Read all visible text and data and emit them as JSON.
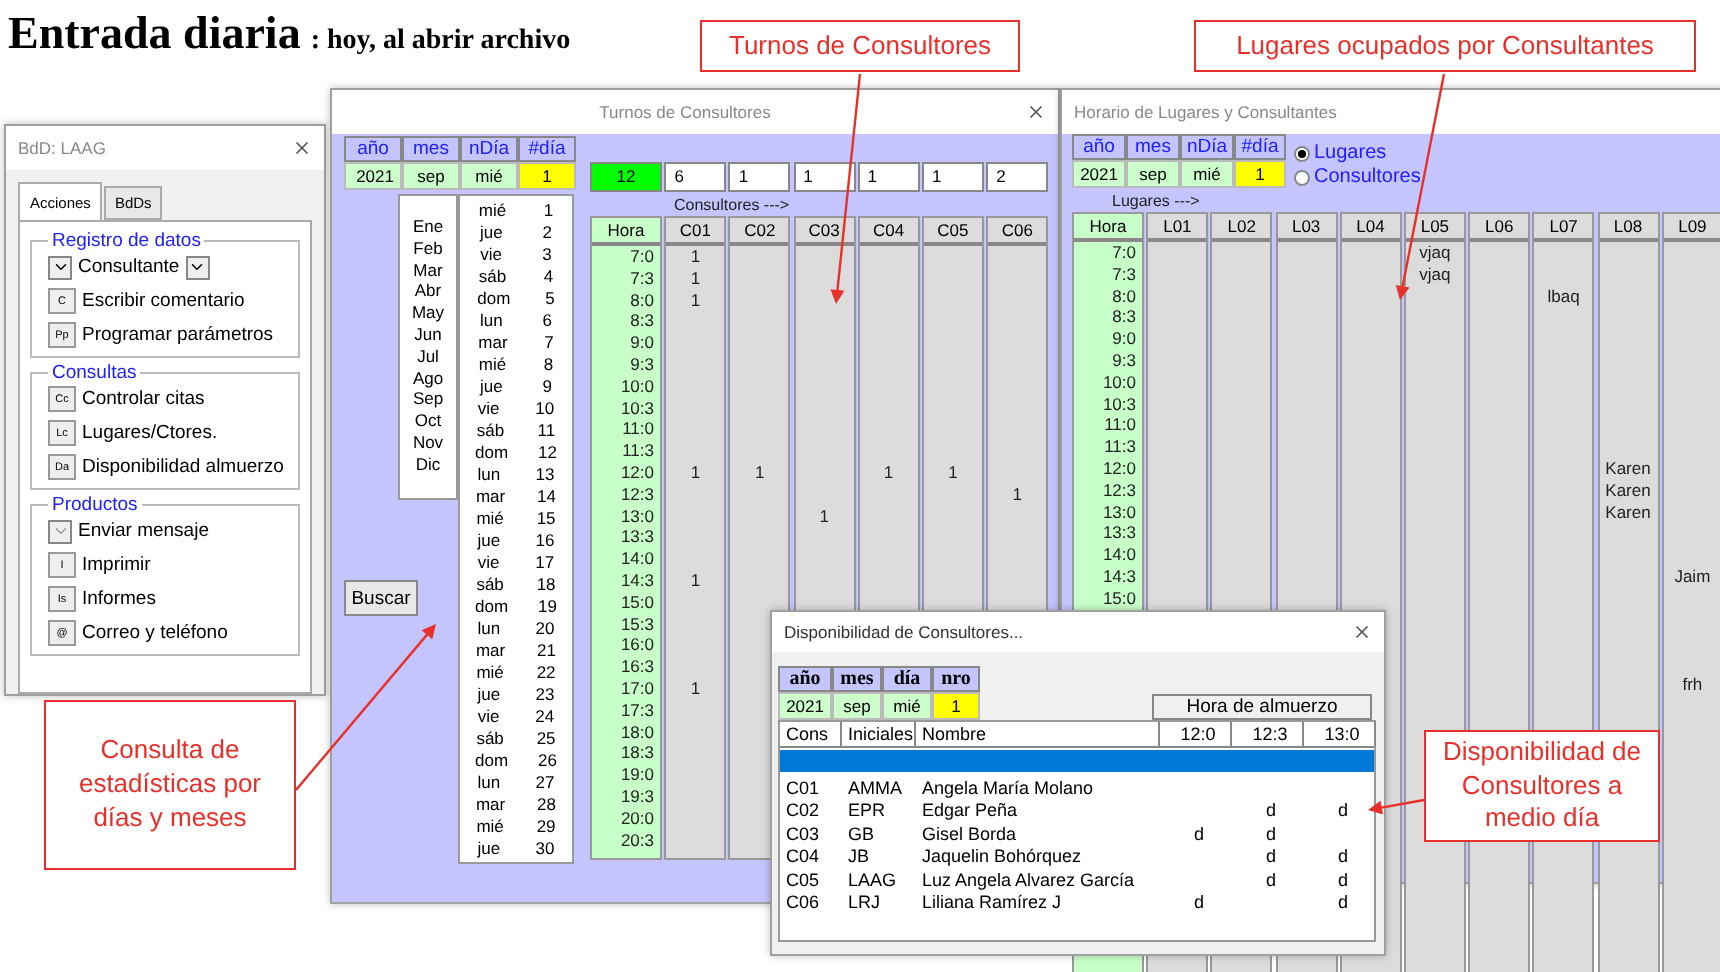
{
  "heading": {
    "main": "Entrada diaria",
    "sub": ": hoy, al abrir archivo"
  },
  "callouts": [
    {
      "text": "Turnos de Consultores"
    },
    {
      "text": "Lugares ocupados por Consultantes"
    },
    {
      "text": "Consulta de estadísticas por días y meses"
    },
    {
      "text": "Disponibilidad de Consultores a medio día"
    }
  ],
  "panel": {
    "title": "BdD: LAAG",
    "tabs": [
      {
        "label": "Acciones",
        "selected": true
      },
      {
        "label": "BdDs",
        "selected": false
      }
    ],
    "groups": [
      {
        "title": "Registro de datos",
        "items": [
          {
            "kind": "picker",
            "label": "Consultante"
          },
          {
            "kind": "key",
            "key": "C",
            "label": "Escribir comentario"
          },
          {
            "kind": "key",
            "key": "Pp",
            "label": "Programar parámetros"
          }
        ]
      },
      {
        "title": "Consultas",
        "items": [
          {
            "kind": "key",
            "key": "Cc",
            "label": "Controlar citas"
          },
          {
            "kind": "key",
            "key": "Lc",
            "label": "Lugares/Ctores."
          },
          {
            "kind": "key",
            "key": "Da",
            "label": "Disponibilidad almuerzo"
          }
        ]
      },
      {
        "title": "Productos",
        "items": [
          {
            "kind": "dropdown",
            "label": "Enviar mensaje"
          },
          {
            "kind": "key",
            "key": "I",
            "label": "Imprimir"
          },
          {
            "kind": "key",
            "key": "Is",
            "label": "Informes"
          },
          {
            "kind": "key",
            "key": "@",
            "label": "Correo y teléfono"
          }
        ]
      }
    ]
  },
  "turnos": {
    "title": "Turnos de Consultores",
    "date": {
      "labels": [
        "año",
        "mes",
        "nDía",
        "#día"
      ],
      "values": [
        {
          "text": "2021",
          "color": "#ccffcc"
        },
        {
          "text": "sep",
          "color": "#ccffcc"
        },
        {
          "text": "mié",
          "color": "#ccffcc"
        },
        {
          "text": "1",
          "color": "#ffff00"
        }
      ]
    },
    "months": [
      "Ene",
      "Feb",
      "Mar",
      "Abr",
      "May",
      "Jun",
      "Jul",
      "Ago",
      "Sep",
      "Oct",
      "Nov",
      "Dic"
    ],
    "days": [
      {
        "weekday": "mié",
        "day": "1"
      },
      {
        "weekday": "jue",
        "day": "2"
      },
      {
        "weekday": "vie",
        "day": "3"
      },
      {
        "weekday": "sáb",
        "day": "4"
      },
      {
        "weekday": "dom",
        "day": "5"
      },
      {
        "weekday": "lun",
        "day": "6"
      },
      {
        "weekday": "mar",
        "day": "7"
      },
      {
        "weekday": "mié",
        "day": "8"
      },
      {
        "weekday": "jue",
        "day": "9"
      },
      {
        "weekday": "vie",
        "day": "10"
      },
      {
        "weekday": "sáb",
        "day": "11"
      },
      {
        "weekday": "dom",
        "day": "12"
      },
      {
        "weekday": "lun",
        "day": "13"
      },
      {
        "weekday": "mar",
        "day": "14"
      },
      {
        "weekday": "mié",
        "day": "15"
      },
      {
        "weekday": "jue",
        "day": "16"
      },
      {
        "weekday": "vie",
        "day": "17"
      },
      {
        "weekday": "sáb",
        "day": "18"
      },
      {
        "weekday": "dom",
        "day": "19"
      },
      {
        "weekday": "lun",
        "day": "20"
      },
      {
        "weekday": "mar",
        "day": "21"
      },
      {
        "weekday": "mié",
        "day": "22"
      },
      {
        "weekday": "jue",
        "day": "23"
      },
      {
        "weekday": "vie",
        "day": "24"
      },
      {
        "weekday": "sáb",
        "day": "25"
      },
      {
        "weekday": "dom",
        "day": "26"
      },
      {
        "weekday": "lun",
        "day": "27"
      },
      {
        "weekday": "mar",
        "day": "28"
      },
      {
        "weekday": "mié",
        "day": "29"
      },
      {
        "weekday": "jue",
        "day": "30"
      }
    ],
    "search_button": "Buscar",
    "counts": [
      {
        "text": "12",
        "color": "#00ff00"
      },
      {
        "text": "6",
        "color": "#ffffff"
      },
      {
        "text": "1",
        "color": "#ffffff"
      },
      {
        "text": "1",
        "color": "#ffffff"
      },
      {
        "text": "1",
        "color": "#ffffff"
      },
      {
        "text": "1",
        "color": "#ffffff"
      },
      {
        "text": "2",
        "color": "#ffffff"
      }
    ],
    "group_label": "Consultores --->",
    "hour_label": "Hora",
    "times": [
      "7:0",
      "7:3",
      "8:0",
      "8:3",
      "9:0",
      "9:3",
      "10:0",
      "10:3",
      "11:0",
      "11:3",
      "12:0",
      "12:3",
      "13:0",
      "13:3",
      "14:0",
      "14:3",
      "15:0",
      "15:3",
      "16:0",
      "16:3",
      "17:0",
      "17:3",
      "18:0",
      "18:3",
      "19:0",
      "19:3",
      "20:0",
      "20:3"
    ],
    "columns": [
      {
        "label": "C01",
        "cells": [
          "1",
          "1",
          "1",
          null,
          null,
          null,
          null,
          null,
          null,
          null,
          "1",
          null,
          null,
          null,
          null,
          "1",
          null,
          null,
          null,
          null,
          "1"
        ]
      },
      {
        "label": "C02",
        "cells": [
          null,
          null,
          null,
          null,
          null,
          null,
          null,
          null,
          null,
          null,
          "1"
        ]
      },
      {
        "label": "C03",
        "cells": [
          null,
          null,
          null,
          null,
          null,
          null,
          null,
          null,
          null,
          null,
          null,
          null,
          "1"
        ]
      },
      {
        "label": "C04",
        "cells": [
          null,
          null,
          null,
          null,
          null,
          null,
          null,
          null,
          null,
          null,
          "1"
        ]
      },
      {
        "label": "C05",
        "cells": [
          null,
          null,
          null,
          null,
          null,
          null,
          null,
          null,
          null,
          null,
          "1"
        ]
      },
      {
        "label": "C06",
        "cells": [
          null,
          null,
          null,
          null,
          null,
          null,
          null,
          null,
          null,
          null,
          null,
          "1"
        ]
      }
    ]
  },
  "horario": {
    "title": "Horario de Lugares y Consultantes",
    "date": {
      "labels": [
        "año",
        "mes",
        "nDía",
        "#día"
      ],
      "values": [
        {
          "text": "2021",
          "color": "#ccffcc"
        },
        {
          "text": "sep",
          "color": "#ccffcc"
        },
        {
          "text": "mié",
          "color": "#ccffcc"
        },
        {
          "text": "1",
          "color": "#ffff00"
        }
      ]
    },
    "options": [
      {
        "label": "Lugares",
        "selected": true
      },
      {
        "label": "Consultores",
        "selected": false
      }
    ],
    "group_label": "Lugares --->",
    "hour_label": "Hora",
    "times": [
      "7:0",
      "7:3",
      "8:0",
      "8:3",
      "9:0",
      "9:3",
      "10:0",
      "10:3",
      "11:0",
      "11:3",
      "12:0",
      "12:3",
      "13:0",
      "13:3",
      "14:0",
      "14:3",
      "15:0"
    ],
    "columns": [
      {
        "label": "L01"
      },
      {
        "label": "L02"
      },
      {
        "label": "L03"
      },
      {
        "label": "L04"
      },
      {
        "label": "L05",
        "cells": [
          "vjaq",
          "vjaq"
        ]
      },
      {
        "label": "L06"
      },
      {
        "label": "L07",
        "cells": [
          null,
          null,
          "lbaq"
        ]
      },
      {
        "label": "L08",
        "cells": [
          null,
          null,
          null,
          null,
          null,
          null,
          null,
          null,
          null,
          null,
          "Karen",
          "Karen",
          "Karen"
        ]
      },
      {
        "label": "L09",
        "cells": [
          null,
          null,
          null,
          null,
          null,
          null,
          null,
          null,
          null,
          null,
          null,
          null,
          null,
          null,
          null,
          "Jaim",
          null,
          null,
          null,
          null,
          "frh"
        ]
      }
    ]
  },
  "dialog": {
    "title": "Disponibilidad de Consultores...",
    "date": {
      "labels": [
        "año",
        "mes",
        "día",
        "nro"
      ],
      "values": [
        {
          "text": "2021",
          "color": "#ccffcc"
        },
        {
          "text": "sep",
          "color": "#ccffcc"
        },
        {
          "text": "mié",
          "color": "#ccffcc"
        },
        {
          "text": "1",
          "color": "#ffff00"
        }
      ]
    },
    "lunch_header": "Hora de almuerzo",
    "columns": [
      "Cons",
      "Iniciales",
      "Nombre",
      "12:0",
      "12:3",
      "13:0"
    ],
    "blank_row_selected": true,
    "rows": [
      {
        "code": "C01",
        "initials": "AMMA",
        "name": "Angela María Molano"
      },
      {
        "code": "C02",
        "initials": "EPR",
        "name": "Edgar Peña",
        "slot_2": "d",
        "slot_3": "d"
      },
      {
        "code": "C03",
        "initials": "GB",
        "name": "Gisel Borda",
        "slot_1": "d",
        "slot_2": "d"
      },
      {
        "code": "C04",
        "initials": "JB",
        "name": "Jaquelin Bohórquez",
        "slot_2": "d",
        "slot_3": "d"
      },
      {
        "code": "C05",
        "initials": "LAAG",
        "name": "Luz Angela Alvarez García",
        "slot_2": "d",
        "slot_3": "d"
      },
      {
        "code": "C06",
        "initials": "LRJ",
        "name": "Liliana Ramírez J",
        "slot_1": "d",
        "slot_3": "d"
      }
    ]
  }
}
